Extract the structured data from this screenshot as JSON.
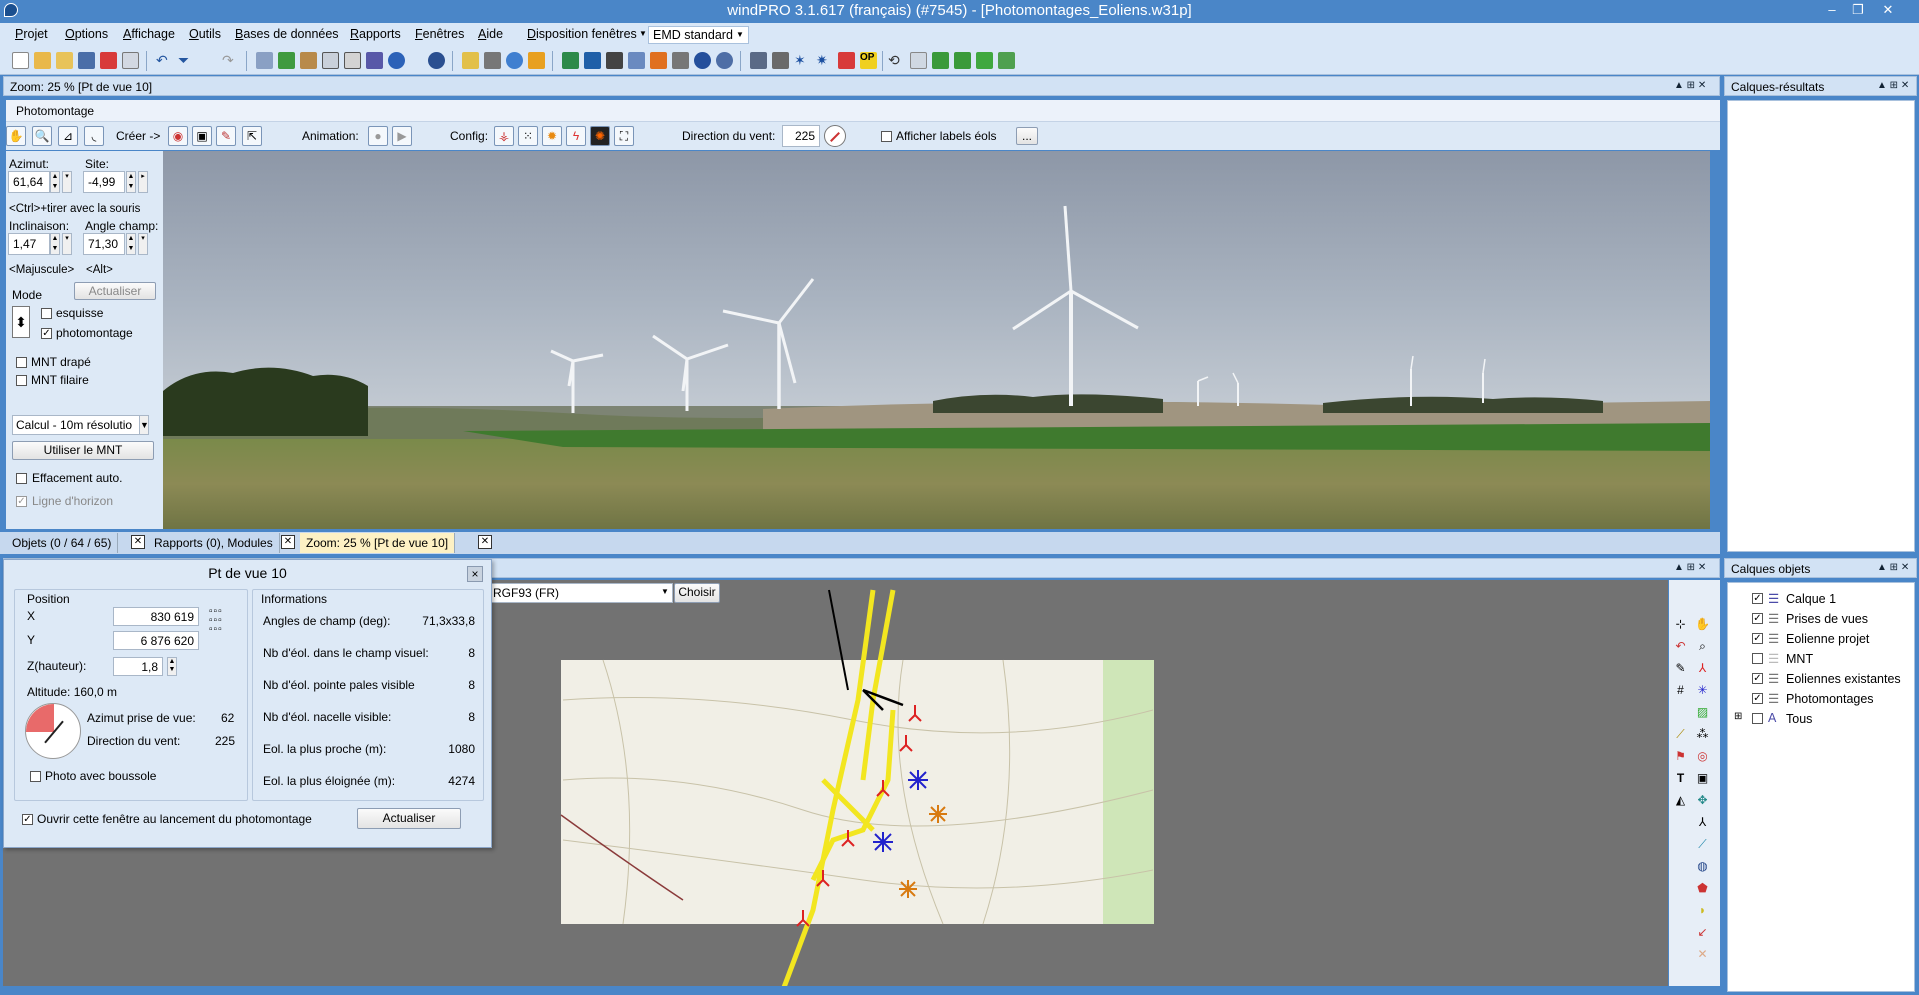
{
  "window": {
    "title": "windPRO 3.1.617 (français) (#7545) - [Photomontages_Eoliens.w31p]",
    "minimize": "–",
    "restore": "❐",
    "close": "✕"
  },
  "menu": {
    "items": [
      "Projet",
      "Options",
      "Affichage",
      "Outils",
      "Bases de données",
      "Rapports",
      "Fenêtres",
      "Aide"
    ],
    "layout_label": "Disposition fenêtres",
    "layout_value": "EMD standard"
  },
  "zoom_panel": {
    "title": "Zoom: 25 % [Pt de vue 10]",
    "subtab": "Photomontage"
  },
  "viewbar": {
    "create_label": "Créer ->",
    "animation_label": "Animation:",
    "config_label": "Config:",
    "wind_label": "Direction du vent:",
    "wind_value": "225",
    "show_labels": "Afficher labels éols",
    "more": "..."
  },
  "left": {
    "azimut_label": "Azimut:",
    "azimut": "61,64",
    "site_label": "Site:",
    "site": "-4,99",
    "hint1": "<Ctrl>+tirer avec la souris",
    "incl_label": "Inclinaison:",
    "incl": "1,47",
    "angle_label": "Angle champ:",
    "angle": "71,30",
    "hint2": "<Majuscule>",
    "hint3": "<Alt>",
    "mode": "Mode",
    "update": "Actualiser",
    "esquisse": "esquisse",
    "photomontage": "photomontage",
    "mnt_drape": "MNT drapé",
    "mnt_filaire": "MNT filaire",
    "calc": "Calcul - 10m résolutio",
    "use_mnt": "Utiliser le MNT",
    "auto_erase": "Effacement auto.",
    "horizon": "Ligne d'horizon"
  },
  "tabs": [
    "Objets (0 / 64 / 65)",
    "Rapports (0), Modules",
    "Zoom: 25 % [Pt de vue 10]"
  ],
  "map": {
    "crs": "RGF93 (FR)",
    "choose": "Choisir"
  },
  "right_top": {
    "title": "Calques-résultats"
  },
  "right_bottom": {
    "title": "Calques objets",
    "items": [
      {
        "label": "Calque 1",
        "checked": true
      },
      {
        "label": "Prises de vues",
        "checked": true
      },
      {
        "label": "Eolienne projet",
        "checked": true
      },
      {
        "label": "MNT",
        "checked": false
      },
      {
        "label": "Eoliennes existantes",
        "checked": true
      },
      {
        "label": "Photomontages",
        "checked": true
      },
      {
        "label": "Tous",
        "checked": false
      }
    ]
  },
  "dialog": {
    "title": "Pt de vue 10",
    "close": "×",
    "position": "Position",
    "x_label": "X",
    "x": "830 619",
    "y_label": "Y",
    "y": "6 876 620",
    "z_label": "Z(hauteur):",
    "z": "1,8",
    "altitude": "Altitude: 160,0 m",
    "azimut_label": "Azimut prise de vue:",
    "azimut": "62",
    "wind_label": "Direction du vent:",
    "wind": "225",
    "compass": "Photo avec boussole",
    "info": "Informations",
    "rows": [
      {
        "label": "Angles de champ (deg):",
        "value": "71,3x33,8"
      },
      {
        "label": "Nb d'éol. dans le champ visuel:",
        "value": "8"
      },
      {
        "label": "Nb d'éol. pointe pales visible",
        "value": "8"
      },
      {
        "label": "Nb d'éol. nacelle visible:",
        "value": "8"
      },
      {
        "label": "Eol. la plus proche (m):",
        "value": "1080"
      },
      {
        "label": "Eol. la plus éloignée (m):",
        "value": "4274"
      }
    ],
    "open_on_start": "Ouvrir cette fenêtre au lancement du photomontage",
    "update": "Actualiser"
  }
}
